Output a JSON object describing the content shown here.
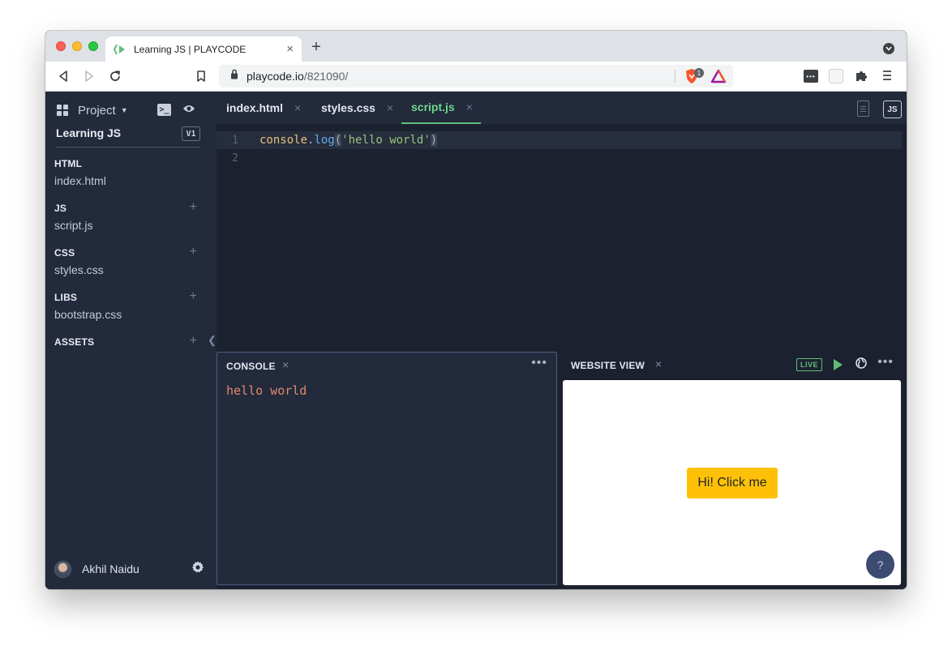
{
  "browser": {
    "tab_title": "Learning JS | PLAYCODE",
    "tab_close": "×",
    "new_tab": "+",
    "url_host": "playcode.io",
    "url_path": "/821090/",
    "shield_badge_count": "1",
    "icons": {
      "back": "back-arrow-icon",
      "forward": "forward-arrow-icon",
      "reload": "reload-icon",
      "bookmark": "bookmark-icon",
      "lock": "lock-icon",
      "extensions": "puzzle-icon",
      "menu": "hamburger-menu-icon"
    }
  },
  "sidebar": {
    "project_label": "Project",
    "project_name": "Learning JS",
    "version": "V1",
    "sections": [
      {
        "title": "HTML",
        "file": "index.html",
        "can_add": false
      },
      {
        "title": "JS",
        "file": "script.js",
        "can_add": true
      },
      {
        "title": "CSS",
        "file": "styles.css",
        "can_add": true
      },
      {
        "title": "LIBS",
        "file": "bootstrap.css",
        "can_add": true
      },
      {
        "title": "ASSETS",
        "file": "",
        "can_add": true
      }
    ],
    "add_symbol": "+",
    "collapse_symbol": "❮",
    "user_name": "Akhil Naidu"
  },
  "editor": {
    "tabs": [
      {
        "label": "index.html",
        "active": false
      },
      {
        "label": "styles.css",
        "active": false
      },
      {
        "label": "script.js",
        "active": true
      }
    ],
    "close_symbol": "×",
    "language_badge": "JS",
    "line_numbers": [
      "1",
      "2"
    ],
    "code": {
      "object": "console",
      "dot": ".",
      "method": "log",
      "open_paren": "(",
      "string": "'hello world'",
      "close_paren": ")"
    }
  },
  "console": {
    "title": "CONSOLE",
    "close_symbol": "×",
    "more_symbol": "•••",
    "output": "hello world"
  },
  "website_view": {
    "title": "WEBSITE VIEW",
    "close_symbol": "×",
    "live_badge": "LIVE",
    "more_symbol": "•••",
    "preview_button": "Hi! Click me",
    "help_button": "?"
  },
  "colors": {
    "accent_green": "#5fbf79",
    "sidebar_bg": "#222a3c",
    "editor_bg": "#1c2130",
    "preview_button": "#ffc107",
    "console_text": "#e08a6a"
  }
}
